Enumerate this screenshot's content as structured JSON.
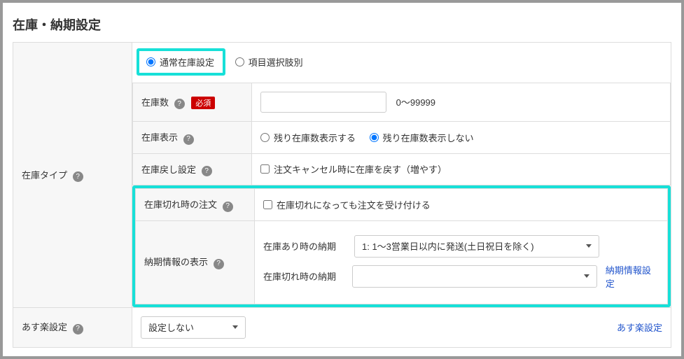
{
  "sectionTitle": "在庫・納期設定",
  "stockType": {
    "label": "在庫タイプ",
    "tab1": "通常在庫設定",
    "tab2": "項目選択肢別"
  },
  "stockQty": {
    "label": "在庫数",
    "required": "必須",
    "hint": "0～99999"
  },
  "stockDisplay": {
    "label": "在庫表示",
    "show": "残り在庫数表示する",
    "hide": "残り在庫数表示しない"
  },
  "stockReturn": {
    "label": "在庫戻し設定",
    "chk": "注文キャンセル時に在庫を戻す（増やす）"
  },
  "outOfStockOrder": {
    "label": "在庫切れ時の注文",
    "chk": "在庫切れになっても注文を受け付ける"
  },
  "delivery": {
    "label": "納期情報の表示",
    "inStockLabel": "在庫あり時の納期",
    "inStockValue": "1: 1～3営業日以内に発送(土日祝日を除く)",
    "outStockLabel": "在庫切れ時の納期",
    "outStockValue": "",
    "link": "納期情報設定"
  },
  "asuraku": {
    "label": "あす楽設定",
    "value": "設定しない",
    "link": "あす楽設定"
  }
}
